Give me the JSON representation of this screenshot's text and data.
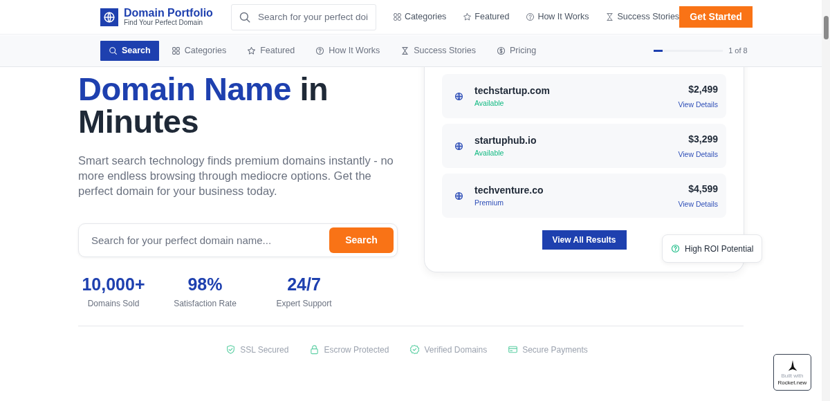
{
  "brand": {
    "title": "Domain Portfolio",
    "subtitle": "Find Your Perfect Domain"
  },
  "top_search": {
    "placeholder": "Search for your perfect doi"
  },
  "top_nav": [
    {
      "label": "Categories"
    },
    {
      "label": "Featured"
    },
    {
      "label": "How It Works"
    },
    {
      "label": "Success Stories"
    }
  ],
  "cta": "Get Started",
  "section_nav": [
    {
      "label": "Search",
      "selected": true
    },
    {
      "label": "Categories",
      "selected": false
    },
    {
      "label": "Featured",
      "selected": false
    },
    {
      "label": "How It Works",
      "selected": false
    },
    {
      "label": "Success Stories",
      "selected": false
    },
    {
      "label": "Pricing",
      "selected": false
    }
  ],
  "progress": {
    "level": 0.125,
    "reading": "1 of 8"
  },
  "hero": {
    "title_lines": [
      {
        "text": "in",
        "accent": "Domain Name"
      },
      {
        "text": "Minutes"
      }
    ],
    "description": "Smart search technology finds premium domains instantly - no more endless browsing through mediocre options. Get the perfect domain for your business today.",
    "search": {
      "placeholder": "Search for your perfect domain name...",
      "button": "Search"
    },
    "stats": [
      {
        "value": "10,000+",
        "label": "Domains Sold"
      },
      {
        "value": "98%",
        "label": "Satisfaction Rate"
      },
      {
        "value": "24/7",
        "label": "Expert Support"
      }
    ]
  },
  "results": [
    {
      "domain": "techstartup.com",
      "status": "Available",
      "color": "#10b981",
      "price": "$2,499",
      "link": "View Details"
    },
    {
      "domain": "startuphub.io",
      "status": "Available",
      "color": "#10b981",
      "price": "$3,299",
      "link": "View Details"
    },
    {
      "domain": "techventure.co",
      "status": "Premium",
      "color": "#2f4fb8",
      "price": "$4,599",
      "link": "View Details"
    }
  ],
  "view_all": "View All Results",
  "roi_badge": "High ROI Potential",
  "trust": [
    {
      "label": "SSL Secured"
    },
    {
      "label": "Escrow Protected"
    },
    {
      "label": "Verified Domains"
    },
    {
      "label": "Secure Payments"
    }
  ],
  "built_badge": {
    "line1": "Built with",
    "line2": "Rocket.new"
  }
}
